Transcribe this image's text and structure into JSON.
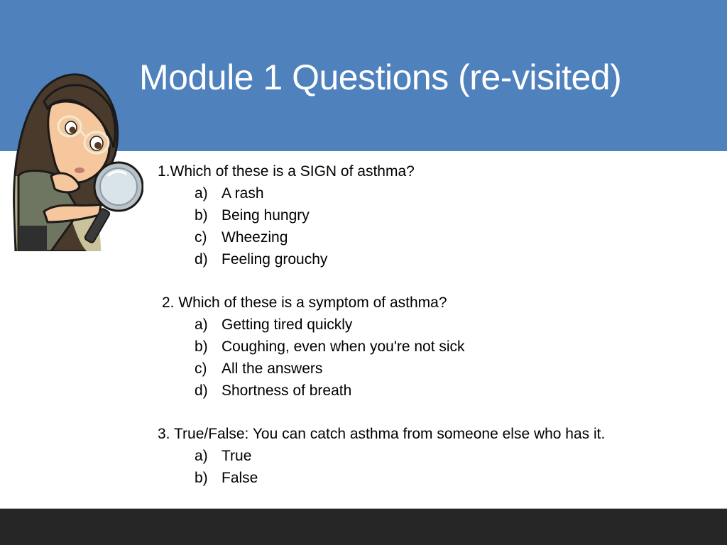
{
  "slide": {
    "title": "Module 1 Questions (re-visited)",
    "header_color": "#4F81BD",
    "bottom_bar_color": "#262626",
    "avatar": {
      "icon": "bitmoji-woman-magnifying-glass-icon",
      "description": "Cartoon woman with glasses looking through a magnifying glass"
    },
    "questions": [
      {
        "text": "1.Which of these is a SIGN of asthma?",
        "options": [
          {
            "letter": "a)",
            "text": "A rash"
          },
          {
            "letter": "b)",
            "text": "Being hungry"
          },
          {
            "letter": "c)",
            "text": "Wheezing"
          },
          {
            "letter": "d)",
            "text": "Feeling grouchy"
          }
        ]
      },
      {
        "text": "2. Which of these is a symptom of asthma?",
        "options": [
          {
            "letter": "a)",
            "text": "Getting tired quickly"
          },
          {
            "letter": "b)",
            "text": "Coughing, even when you're not sick"
          },
          {
            "letter": "c)",
            "text": "All the answers"
          },
          {
            "letter": "d)",
            "text": "Shortness of breath"
          }
        ]
      },
      {
        "text": "3. True/False: You can catch asthma from someone else who has it.",
        "options": [
          {
            "letter": "a)",
            "text": "True"
          },
          {
            "letter": "b)",
            "text": "False"
          }
        ]
      }
    ]
  }
}
